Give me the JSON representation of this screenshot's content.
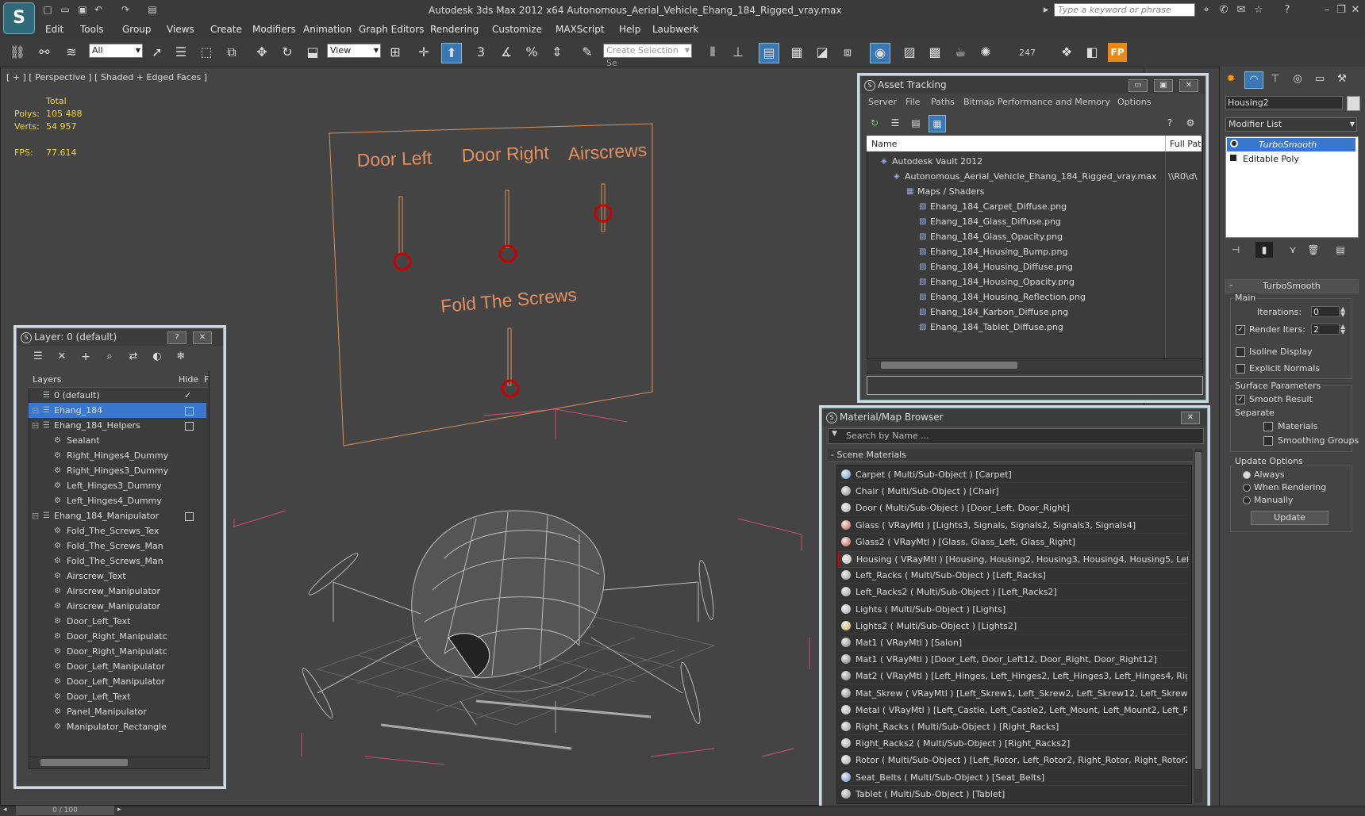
{
  "app": {
    "title": "Autodesk 3ds Max  2012 x64      Autonomous_Aerial_Vehicle_Ehang_184_Rigged_vray.max",
    "logo": "3ds-max-logo",
    "search_placeholder": "Type a keyword or phrase"
  },
  "menu": [
    "Edit",
    "Tools",
    "Group",
    "Views",
    "Create",
    "Modifiers",
    "Animation",
    "Graph Editors",
    "Rendering",
    "Customize",
    "MAXScript",
    "Help",
    "Laubwerk"
  ],
  "toolbar": {
    "selection_filter": "All",
    "ref_coord": "View",
    "selection_set_placeholder": "Create Selection Se",
    "counter": "247",
    "fp_label": "FP"
  },
  "viewport": {
    "label": "[ + ] [ Perspective ] [ Shaded + Edged Faces ]",
    "total_label": "Total",
    "polys_label": "Polys:",
    "polys": "105 488",
    "verts_label": "Verts:",
    "verts": "54 957",
    "fps_label": "FPS:",
    "fps": "77.614",
    "board_labels": {
      "door_left": "Door Left",
      "door_right": "Door Right",
      "airscrews": "Airscrews",
      "fold": "Fold The Screws"
    }
  },
  "layer_panel": {
    "title": "Layer: 0 (default)",
    "col_layers": "Layers",
    "col_hide": "Hide",
    "col_f": "F",
    "rows": [
      {
        "name": "0 (default)",
        "indent": 0,
        "check": true
      },
      {
        "name": "Ehang_184",
        "indent": 0,
        "box": true,
        "selected": true
      },
      {
        "name": "Ehang_184_Helpers",
        "indent": 0,
        "box": true
      },
      {
        "name": "Sealant",
        "indent": 1
      },
      {
        "name": "Right_Hinges4_Dummy",
        "indent": 1
      },
      {
        "name": "Right_Hinges3_Dummy",
        "indent": 1
      },
      {
        "name": "Left_Hinges3_Dummy",
        "indent": 1
      },
      {
        "name": "Left_Hinges4_Dummy",
        "indent": 1
      },
      {
        "name": "Ehang_184_Manipulator",
        "indent": 0,
        "box": true
      },
      {
        "name": "Fold_The_Screws_Tex",
        "indent": 1
      },
      {
        "name": "Fold_The_Screws_Man",
        "indent": 1
      },
      {
        "name": "Fold_The_Screws_Man",
        "indent": 1
      },
      {
        "name": "Airscrew_Text",
        "indent": 1
      },
      {
        "name": "Airscrew_Manipulator",
        "indent": 1
      },
      {
        "name": "Airscrew_Manipulator",
        "indent": 1
      },
      {
        "name": "Door_Left_Text",
        "indent": 1
      },
      {
        "name": "Door_Right_Manipulatc",
        "indent": 1
      },
      {
        "name": "Door_Right_Manipulatc",
        "indent": 1
      },
      {
        "name": "Door_Left_Manipulator",
        "indent": 1
      },
      {
        "name": "Door_Left_Manipulator",
        "indent": 1
      },
      {
        "name": "Door_Left_Text",
        "indent": 1
      },
      {
        "name": "Panel_Manipulator",
        "indent": 1
      },
      {
        "name": "Manipulator_Rectangle",
        "indent": 1
      }
    ]
  },
  "asset_panel": {
    "title": "Asset Tracking",
    "menus": [
      "Server",
      "File",
      "Paths",
      "Bitmap Performance and Memory",
      "Options"
    ],
    "col_name": "Name",
    "col_path": "Full Pat",
    "rows": [
      {
        "name": "Autodesk Vault 2012",
        "indent": 1,
        "path": ""
      },
      {
        "name": "Autonomous_Aerial_Vehicle_Ehang_184_Rigged_vray.max",
        "indent": 2,
        "path": "\\\\R0\\d\\"
      },
      {
        "name": "Maps / Shaders",
        "indent": 3,
        "path": ""
      },
      {
        "name": "Ehang_184_Carpet_Diffuse.png",
        "indent": 4,
        "path": ""
      },
      {
        "name": "Ehang_184_Glass_Diffuse.png",
        "indent": 4,
        "path": ""
      },
      {
        "name": "Ehang_184_Glass_Opacity.png",
        "indent": 4,
        "path": ""
      },
      {
        "name": "Ehang_184_Housing_Bump.png",
        "indent": 4,
        "path": ""
      },
      {
        "name": "Ehang_184_Housing_Diffuse.png",
        "indent": 4,
        "path": ""
      },
      {
        "name": "Ehang_184_Housing_Opacity.png",
        "indent": 4,
        "path": ""
      },
      {
        "name": "Ehang_184_Housing_Reflection.png",
        "indent": 4,
        "path": ""
      },
      {
        "name": "Ehang_184_Karbon_Diffuse.png",
        "indent": 4,
        "path": ""
      },
      {
        "name": "Ehang_184_Tablet_Diffuse.png",
        "indent": 4,
        "path": ""
      }
    ]
  },
  "material_panel": {
    "title": "Material/Map Browser",
    "search_placeholder": "Search by Name ...",
    "group": "- Scene Materials",
    "rows": [
      {
        "text": "Carpet  ( Multi/Sub-Object )  [Carpet]",
        "color": "#5a8fd0"
      },
      {
        "text": "Chair  ( Multi/Sub-Object )  [Chair]",
        "color": "#888888"
      },
      {
        "text": "Door  ( Multi/Sub-Object )  [Door_Left, Door_Right]",
        "color": "#aaaaaa"
      },
      {
        "text": "Glass  ( VRayMtl )  [Lights3, Signals, Signals2, Signals3, Signals4]",
        "color": "#d04a3a"
      },
      {
        "text": "Glass2  ( VRayMtl )  [Glass, Glass_Left, Glass_Right]",
        "color": "#d04a3a"
      },
      {
        "text": "Housing  ( VRayMtl )  [Housing, Housing2, Housing3, Housing4, Housing5, Left_...",
        "color": "#bbbbbb",
        "selected": true
      },
      {
        "text": "Left_Racks  ( Multi/Sub-Object )  [Left_Racks]",
        "color": "#999999"
      },
      {
        "text": "Left_Racks2  ( Multi/Sub-Object )  [Left_Racks2]",
        "color": "#999999"
      },
      {
        "text": "Lights  ( Multi/Sub-Object )  [Lights]",
        "color": "#aaaaaa"
      },
      {
        "text": "Lights2  ( Multi/Sub-Object )  [Lights2]",
        "color": "#c9b040"
      },
      {
        "text": "Mat1  ( VRayMtl )  [Salon]",
        "color": "#777777"
      },
      {
        "text": "Mat1  ( VRayMtl )  [Door_Left, Door_Left12, Door_Right, Door_Right12]",
        "color": "#777777"
      },
      {
        "text": "Mat2  ( VRayMtl )  [Left_Hinges, Left_Hinges2, Left_Hinges3, Left_Hinges4, Right...",
        "color": "#777777"
      },
      {
        "text": "Mat_Skrew  ( VRayMtl )  [Left_Skrew1, Left_Skrew2, Left_Skrew12, Left_Skrew2...",
        "color": "#777777"
      },
      {
        "text": "Metal  ( VRayMtl )  [Left_Castle, Left_Castle2, Left_Mount, Left_Mount2, Left_Ra...",
        "color": "#aaaaaa"
      },
      {
        "text": "Right_Racks  ( Multi/Sub-Object )  [Right_Racks]",
        "color": "#999999"
      },
      {
        "text": "Right_Racks2  ( Multi/Sub-Object )  [Right_Racks2]",
        "color": "#999999"
      },
      {
        "text": "Rotor  ( Multi/Sub-Object )  [Left_Rotor, Left_Rotor2, Right_Rotor, Right_Rotor2]",
        "color": "#aaaaaa"
      },
      {
        "text": "Seat_Belts  ( Multi/Sub-Object )  [Seat_Belts]",
        "color": "#5a8fd0"
      },
      {
        "text": "Tablet  ( Multi/Sub-Object )  [Tablet]",
        "color": "#888888"
      }
    ]
  },
  "command_panel": {
    "object_name": "Housing2",
    "modifier_list": "Modifier List",
    "stack": [
      "TurboSmooth",
      "Editable Poly"
    ],
    "rollout_title": "TurboSmooth",
    "main_label": "Main",
    "iterations_label": "Iterations:",
    "iterations": "0",
    "render_iters_label": "Render Iters:",
    "render_iters": "2",
    "isoline": "Isoline Display",
    "explicit_normals": "Explicit Normals",
    "surface_params": "Surface Parameters",
    "smooth_result": "Smooth Result",
    "separate": "Separate",
    "materials": "Materials",
    "smoothing_groups": "Smoothing Groups",
    "update_options": "Update Options",
    "always": "Always",
    "when_rendering": "When Rendering",
    "manually": "Manually",
    "update_button": "Update"
  },
  "status": {
    "frame": "0 / 100"
  }
}
